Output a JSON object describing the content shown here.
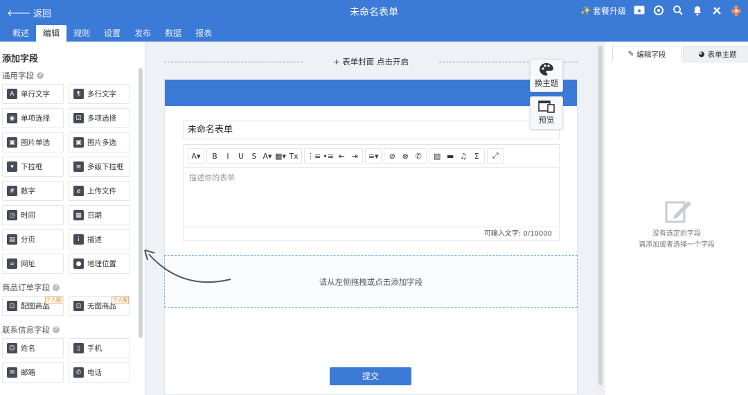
{
  "topbar": {
    "back_label": "返回",
    "title": "未命名表单",
    "upgrade_label": "套餐升级",
    "icons": [
      "star-box-icon",
      "refresh-icon",
      "search-icon",
      "bell-icon",
      "tools-icon",
      "flower-logo-icon"
    ]
  },
  "tabs": [
    {
      "label": "概述",
      "active": false
    },
    {
      "label": "编辑",
      "active": true
    },
    {
      "label": "规则",
      "active": false
    },
    {
      "label": "设置",
      "active": false
    },
    {
      "label": "发布",
      "active": false
    },
    {
      "label": "数据",
      "active": false
    },
    {
      "label": "报表",
      "active": false
    }
  ],
  "left": {
    "heading": "添加字段",
    "sections": {
      "common": "通用字段",
      "order": "商品订单字段",
      "contact": "联系信息字段"
    },
    "common_fields": [
      {
        "label": "单行文字",
        "icon": "A"
      },
      {
        "label": "多行文字",
        "icon": "¶"
      },
      {
        "label": "单项选择",
        "icon": "◉"
      },
      {
        "label": "多项选择",
        "icon": "☑"
      },
      {
        "label": "图片单选",
        "icon": "▣"
      },
      {
        "label": "图片多选",
        "icon": "▣"
      },
      {
        "label": "下拉框",
        "icon": "▾"
      },
      {
        "label": "多级下拉框",
        "icon": "≡"
      },
      {
        "label": "数字",
        "icon": "#"
      },
      {
        "label": "上传文件",
        "icon": "⌀"
      },
      {
        "label": "时间",
        "icon": "◷"
      },
      {
        "label": "日期",
        "icon": "▦"
      },
      {
        "label": "分页",
        "icon": "▤"
      },
      {
        "label": "描述",
        "icon": "i"
      },
      {
        "label": "网址",
        "icon": "∞"
      },
      {
        "label": "地理位置",
        "icon": "●"
      }
    ],
    "order_fields": [
      {
        "label": "配图商品",
        "icon": "⊡",
        "badge": "个人版"
      },
      {
        "label": "无图商品",
        "icon": "⊡",
        "badge": "个人版"
      }
    ],
    "contact_fields": [
      {
        "label": "姓名",
        "icon": "☺"
      },
      {
        "label": "手机",
        "icon": "▯"
      },
      {
        "label": "邮箱",
        "icon": "✉"
      },
      {
        "label": "电话",
        "icon": "✆"
      }
    ]
  },
  "canvas": {
    "cover_label": "+  表单封面 点击开启",
    "form_name": "未命名表单",
    "desc_placeholder": "描述你的表单",
    "char_count": "可输入文字: 0/10000",
    "drop_hint": "请从左侧拖拽或点击添加字段",
    "submit_label": "提交",
    "theme_button": "换主题",
    "preview_button": "预览",
    "toolbar_groups": [
      [
        "A▾"
      ],
      [
        "B",
        "I",
        "U",
        "S",
        "A▾",
        "▩▾",
        "Tx"
      ],
      [
        "⋮≡",
        "•≡",
        "⇤",
        "⇥"
      ],
      [
        "≡▾"
      ],
      [
        "⊘",
        "⊗",
        "✆"
      ],
      [
        "▨",
        "▬",
        "♫",
        "Σ"
      ],
      [
        "⤢"
      ]
    ]
  },
  "right": {
    "tab_edit": "编辑字段",
    "tab_theme": "表单主题",
    "empty_line1": "没有选定的字段",
    "empty_line2": "请添加或者选择一个字段"
  },
  "colors": {
    "brand": "#3c7ad8",
    "drop_border": "#7ab0e0"
  }
}
